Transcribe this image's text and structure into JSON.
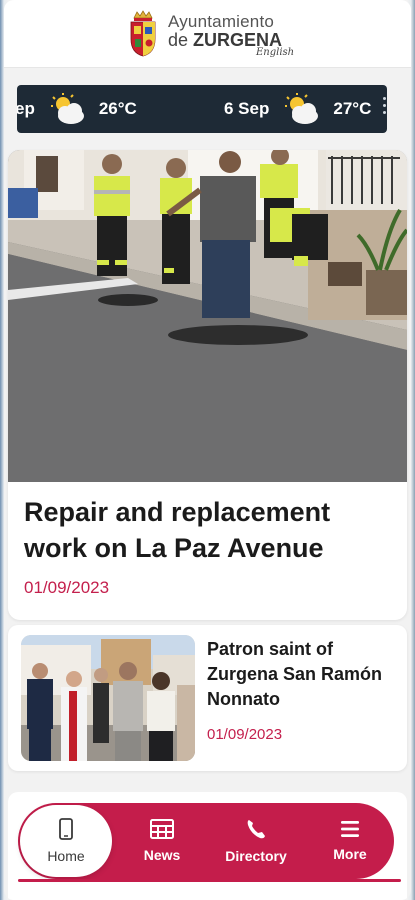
{
  "header": {
    "brand_line1": "Ayuntamiento",
    "brand_line2_prefix": "de",
    "brand_line2_name": "ZURGENA",
    "language_link": "English",
    "crest_icon": "coat-of-arms-icon"
  },
  "weather": {
    "items": [
      {
        "date": "ep",
        "temp": "26°C",
        "icon": "partly-cloudy-icon"
      },
      {
        "date": "6 Sep",
        "temp": "27°C",
        "icon": "partly-cloudy-icon"
      }
    ]
  },
  "news": [
    {
      "title": "Repair and replacement work on La Paz Avenue",
      "date": "01/09/2023"
    },
    {
      "title": "Patron saint of Zurgena San Ramón Nonnato",
      "date": "01/09/2023"
    }
  ],
  "nav": {
    "home": "Home",
    "news": "News",
    "directory": "Directory",
    "more": "More"
  },
  "colors": {
    "accent": "#c41d4b",
    "date_text": "#c4204d",
    "weather_bg": "#1e2a36"
  }
}
